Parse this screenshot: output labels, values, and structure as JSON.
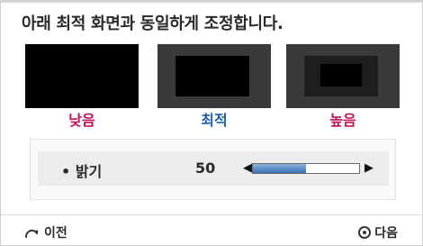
{
  "title": "아래 최적 화면과 동일하게 조정합니다.",
  "previews": {
    "low_label": "낮음",
    "optimal_label": "최적",
    "high_label": "높음"
  },
  "setting": {
    "bullet": "•",
    "label": "밝기",
    "value": "50",
    "level_fraction": 0.5,
    "left_arrow": "◀",
    "right_arrow": "▶"
  },
  "footer": {
    "back_label": "이전",
    "next_label": "다음"
  },
  "colors": {
    "low_label": "#c0145a",
    "optimal_label": "#1a5fa8",
    "high_label": "#c0145a",
    "slider_fill": "#3a6fb2"
  }
}
